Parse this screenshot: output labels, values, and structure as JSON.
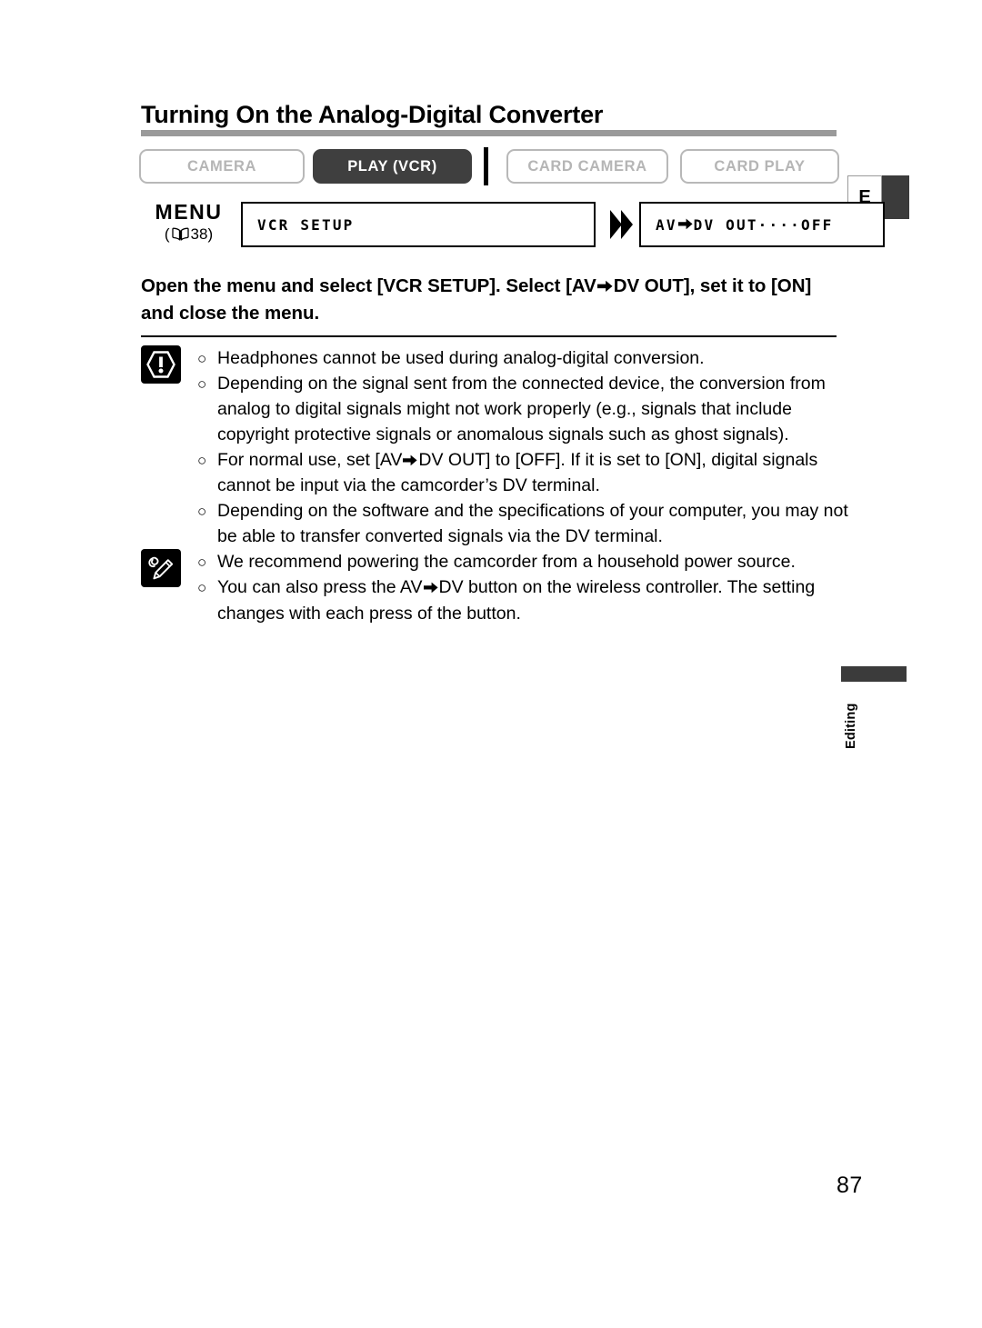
{
  "page": {
    "title": "Turning On the Analog-Digital Converter",
    "number": "87",
    "language_tab": "E",
    "side_tab_label": "Editing"
  },
  "mode_bar": {
    "buttons": [
      {
        "label": "CAMERA",
        "state": "inactive",
        "name": "mode-camera"
      },
      {
        "label": "PLAY (VCR)",
        "state": "active",
        "name": "mode-play-vcr"
      },
      {
        "label": "CARD CAMERA",
        "state": "inactive",
        "name": "mode-card-camera"
      },
      {
        "label": "CARD PLAY",
        "state": "inactive",
        "name": "mode-card-play"
      }
    ]
  },
  "menu_row": {
    "label": "MENU",
    "reference_open": "(",
    "reference_page": "38",
    "reference_close": ")",
    "book_icon": "open-book-icon",
    "arrow_icon": "double-chevron-right-icon",
    "box_1": "VCR SETUP",
    "box_2_prefix": "AV",
    "box_2_arrow": "arrow-right-icon",
    "box_2_suffix": "DV OUT····OFF"
  },
  "instruction": {
    "part_1": "Open the menu and select [VCR SETUP]. Select [AV",
    "arrow": "arrow-right-icon",
    "part_2": "DV OUT], set it to [ON] and close the menu."
  },
  "notes": {
    "warning": {
      "icon": "warning-exclamation-icon",
      "bullet": "○",
      "items": [
        {
          "text": "Headphones cannot be used during analog-digital conversion."
        },
        {
          "text": "Depending on the signal sent from the connected device, the conversion from analog to digital signals might not work properly (e.g., signals that include copyright protective signals or anomalous signals such as ghost signals)."
        },
        {
          "part_1": "For normal use, set [AV",
          "arrow": "arrow-right-icon",
          "part_2": "DV OUT] to [OFF]. If it is set to [ON], digital signals cannot be input via the camcorder’s DV terminal."
        },
        {
          "text": "Depending on the software and the specifications of your computer, you may not be able to transfer converted signals via the DV terminal."
        }
      ]
    },
    "tips": {
      "icon": "note-pencil-icon",
      "bullet": "○",
      "items": [
        {
          "text": "We recommend powering the camcorder from a household power source."
        },
        {
          "part_1": "You can also press the AV",
          "arrow": "arrow-right-icon",
          "part_2": "DV button on the wireless controller. The setting changes with each press of the button."
        }
      ]
    }
  },
  "colors": {
    "active_button_bg": "#3f3f3f",
    "inactive_button_border": "#b8b8b8",
    "inactive_button_text": "#b5b5b5",
    "title_rule": "#9a9a9a",
    "side_tab_bar": "#3b3b3b",
    "text": "#000000"
  }
}
